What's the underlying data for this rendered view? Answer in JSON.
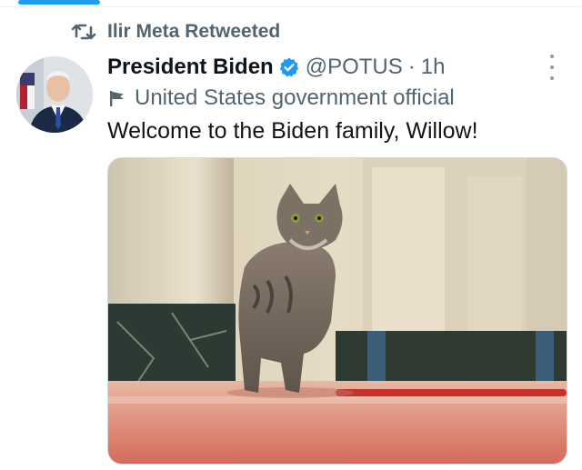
{
  "retweet": {
    "text": "Ilir Meta Retweeted",
    "icon": "retweet-icon"
  },
  "author": {
    "display_name": "President Biden",
    "handle": "@POTUS",
    "separator": "·",
    "time": "1h",
    "verified_icon": "verified-badge-icon",
    "label_icon": "flag-icon",
    "label": "United States government official"
  },
  "tweet": {
    "text": "Welcome to the Biden family, Willow!"
  },
  "colors": {
    "accent": "#1d9bf0",
    "secondary_text": "#536471",
    "primary_text": "#0f1419"
  }
}
